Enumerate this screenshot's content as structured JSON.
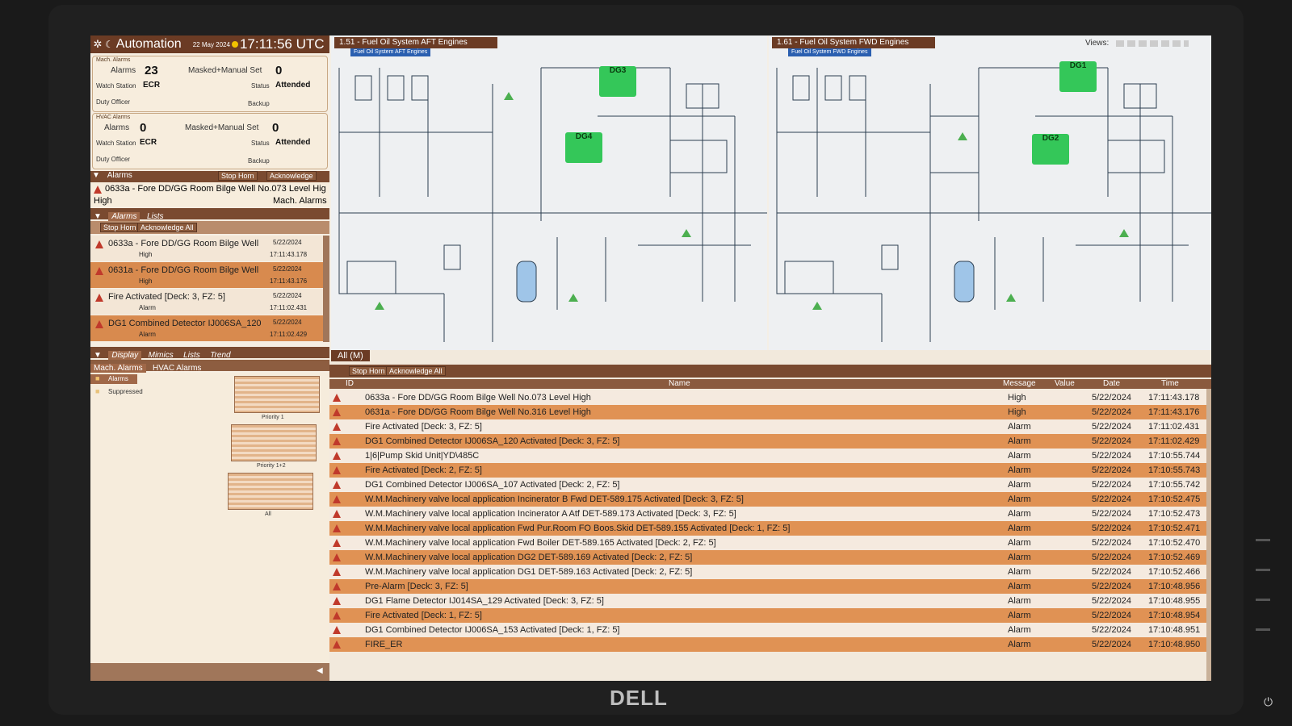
{
  "header": {
    "app_title": "Automation",
    "date": "22 May 2024",
    "time": "17:11:56 UTC"
  },
  "mach_alarms": {
    "title": "Mach. Alarms",
    "alarms_label": "Alarms",
    "alarms_count": "23",
    "masked_label": "Masked+Manual Set",
    "masked_count": "0",
    "watch_label": "Watch Station",
    "watch_value": "ECR",
    "status_label": "Status",
    "status_value": "Attended",
    "duty_label": "Duty Officer",
    "backup_label": "Backup"
  },
  "hvac_alarms": {
    "title": "HVAC Alarms",
    "alarms_label": "Alarms",
    "alarms_count": "0",
    "masked_label": "Masked+Manual Set",
    "masked_count": "0",
    "watch_label": "Watch Station",
    "watch_value": "ECR",
    "status_label": "Status",
    "status_value": "Attended",
    "duty_label": "Duty Officer",
    "backup_label": "Backup"
  },
  "alarms_section": {
    "label": "Alarms",
    "stop_horn": "Stop Horn",
    "acknowledge": "Acknowledge",
    "top_alarm": "0633a - Fore DD/GG Room Bilge Well No.073 Level Hig",
    "top_priority": "High",
    "top_group": "Mach. Alarms"
  },
  "alarms_lists_tabs": [
    "Alarms",
    "Lists"
  ],
  "left_buttons": {
    "stop_horn": "Stop Horn",
    "ack_all": "Acknowledge All"
  },
  "left_alarms": [
    {
      "name": "0633a - Fore DD/GG Room Bilge Well Nc",
      "date": "5/22/2024",
      "priority": "High",
      "time": "17:11:43.178",
      "style": "lt"
    },
    {
      "name": "0631a - Fore DD/GG Room Bilge Well Nc",
      "date": "5/22/2024",
      "priority": "High",
      "time": "17:11:43.176",
      "style": "or"
    },
    {
      "name": "Fire Activated [Deck: 3, FZ: 5]",
      "date": "5/22/2024",
      "priority": "Alarm",
      "time": "17:11:02.431",
      "style": "lt"
    },
    {
      "name": "DG1 Combined Detector IJ006SA_120 A",
      "date": "5/22/2024",
      "priority": "Alarm",
      "time": "17:11:02.429",
      "style": "or"
    }
  ],
  "display_tabs": [
    "Display",
    "Mimics",
    "Lists",
    "Trend"
  ],
  "sub_tabs": [
    "Mach. Alarms",
    "HVAC Alarms"
  ],
  "tree": {
    "alarms": "Alarms",
    "suppressed": "Suppressed"
  },
  "thumbs": [
    "Priority 1",
    "Priority 1+2",
    "All"
  ],
  "mimic_aft": {
    "title": "1.51 - Fuel Oil System AFT Engines",
    "sub": "Fuel Oil System AFT Engines",
    "engines": [
      "DG3",
      "DG4"
    ]
  },
  "mimic_fwd": {
    "title": "1.61 - Fuel Oil System FWD Engines",
    "sub": "Fuel Oil System FWD Engines",
    "engines": [
      "DG1",
      "DG2"
    ]
  },
  "views_label": "Views:",
  "list": {
    "tab": "All (M)",
    "stop_horn": "Stop Horn",
    "ack_all": "Acknowledge All",
    "columns": {
      "id": "ID",
      "name": "Name",
      "message": "Message",
      "value": "Value",
      "date": "Date",
      "time": "Time"
    },
    "rows": [
      {
        "name": "0633a - Fore DD/GG Room Bilge Well No.073 Level High",
        "message": "High",
        "date": "5/22/2024",
        "time": "17:11:43.178",
        "style": "lt"
      },
      {
        "name": "0631a - Fore DD/GG Room Bilge Well No.316 Level High",
        "message": "High",
        "date": "5/22/2024",
        "time": "17:11:43.176",
        "style": "or"
      },
      {
        "name": "Fire Activated [Deck: 3, FZ: 5]",
        "message": "Alarm",
        "date": "5/22/2024",
        "time": "17:11:02.431",
        "style": "lt"
      },
      {
        "name": "DG1 Combined Detector IJ006SA_120 Activated [Deck: 3, FZ: 5]",
        "message": "Alarm",
        "date": "5/22/2024",
        "time": "17:11:02.429",
        "style": "or"
      },
      {
        "name": "1|6|Pump Skid Unit|YD\\485C",
        "message": "Alarm",
        "date": "5/22/2024",
        "time": "17:10:55.744",
        "style": "lt"
      },
      {
        "name": "Fire Activated [Deck: 2, FZ: 5]",
        "message": "Alarm",
        "date": "5/22/2024",
        "time": "17:10:55.743",
        "style": "or"
      },
      {
        "name": "DG1 Combined Detector IJ006SA_107 Activated [Deck: 2, FZ: 5]",
        "message": "Alarm",
        "date": "5/22/2024",
        "time": "17:10:55.742",
        "style": "lt"
      },
      {
        "name": "W.M.Machinery valve local application Incinerator B Fwd DET-589.175 Activated [Deck: 3, FZ: 5]",
        "message": "Alarm",
        "date": "5/22/2024",
        "time": "17:10:52.475",
        "style": "or"
      },
      {
        "name": "W.M.Machinery valve local application Incinerator A Atf DET-589.173 Activated [Deck: 3, FZ: 5]",
        "message": "Alarm",
        "date": "5/22/2024",
        "time": "17:10:52.473",
        "style": "lt"
      },
      {
        "name": "W.M.Machinery valve local application Fwd Pur.Room FO Boos.Skid DET-589.155 Activated [Deck: 1, FZ: 5]",
        "message": "Alarm",
        "date": "5/22/2024",
        "time": "17:10:52.471",
        "style": "or"
      },
      {
        "name": "W.M.Machinery valve local application Fwd Boiler DET-589.165 Activated [Deck: 2, FZ: 5]",
        "message": "Alarm",
        "date": "5/22/2024",
        "time": "17:10:52.470",
        "style": "lt"
      },
      {
        "name": "W.M.Machinery valve local application DG2 DET-589.169 Activated [Deck: 2, FZ: 5]",
        "message": "Alarm",
        "date": "5/22/2024",
        "time": "17:10:52.469",
        "style": "or"
      },
      {
        "name": "W.M.Machinery valve local application DG1 DET-589.163 Activated [Deck: 2, FZ: 5]",
        "message": "Alarm",
        "date": "5/22/2024",
        "time": "17:10:52.466",
        "style": "lt"
      },
      {
        "name": "Pre-Alarm [Deck: 3, FZ: 5]",
        "message": "Alarm",
        "date": "5/22/2024",
        "time": "17:10:48.956",
        "style": "or"
      },
      {
        "name": "DG1 Flame Detector IJ014SA_129 Activated [Deck: 3, FZ: 5]",
        "message": "Alarm",
        "date": "5/22/2024",
        "time": "17:10:48.955",
        "style": "lt"
      },
      {
        "name": "Fire Activated [Deck: 1, FZ: 5]",
        "message": "Alarm",
        "date": "5/22/2024",
        "time": "17:10:48.954",
        "style": "or"
      },
      {
        "name": "DG1 Combined Detector IJ006SA_153 Activated [Deck: 1, FZ: 5]",
        "message": "Alarm",
        "date": "5/22/2024",
        "time": "17:10:48.951",
        "style": "lt"
      },
      {
        "name": "FIRE_ER",
        "message": "Alarm",
        "date": "5/22/2024",
        "time": "17:10:48.950",
        "style": "or"
      }
    ]
  },
  "brand": "DELL",
  "colors": {
    "accent_brown": "#6b3b24",
    "alarm_orange": "#e09254",
    "engine_green": "#34c759",
    "alarm_red": "#c0392b"
  }
}
